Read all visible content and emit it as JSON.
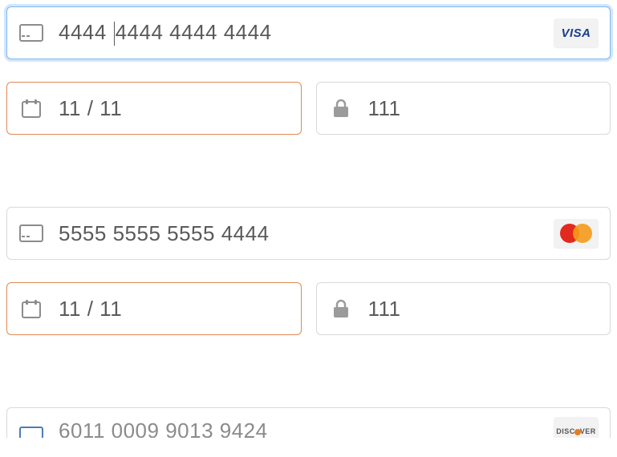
{
  "cards": [
    {
      "number_segments": [
        "4444 ",
        "4444 4444 4444"
      ],
      "number_has_cursor": true,
      "expiry": "11 / 11",
      "cvc": "111",
      "brand": "visa",
      "number_focused": true,
      "expiry_error": true
    },
    {
      "number_segments": [
        "5555 5555 5555 4444"
      ],
      "number_has_cursor": false,
      "expiry": "11 / 11",
      "cvc": "111",
      "brand": "mastercard",
      "number_focused": false,
      "expiry_error": true
    },
    {
      "number_segments": [
        "6011 0009 9013 9424"
      ],
      "number_has_cursor": false,
      "expiry": "",
      "cvc": "",
      "brand": "discover",
      "number_focused": false,
      "expiry_error": false,
      "partial": true
    }
  ],
  "brand_labels": {
    "visa": "VISA",
    "discover_pre": "DISC",
    "discover_post": "VER"
  }
}
